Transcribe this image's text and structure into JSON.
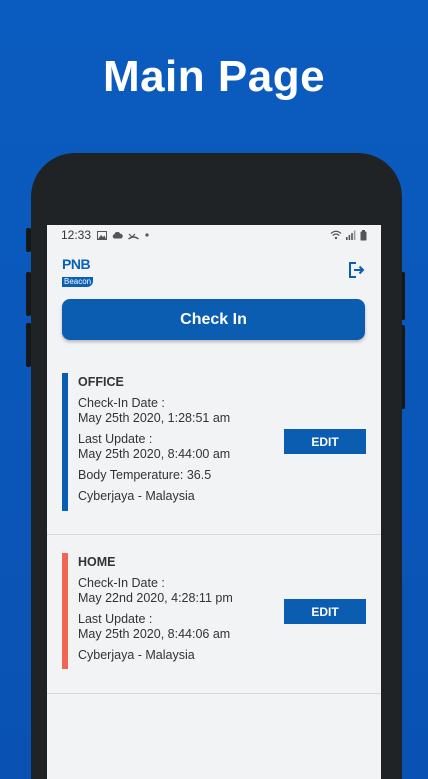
{
  "page_heading": "Main Page",
  "status_bar": {
    "time": "12:33",
    "left_icons": [
      "image-icon",
      "cloud-icon",
      "missed-call-icon",
      "dot-icon"
    ],
    "right_icons": [
      "wifi-icon",
      "signal-icon",
      "battery-icon"
    ]
  },
  "header": {
    "logo_top": "PNB",
    "logo_bottom": "Beacon",
    "logout_icon": "logout-icon"
  },
  "checkin_button": "Check In",
  "colors": {
    "brand": "#0a5db0",
    "office_accent": "#0a5db0",
    "home_accent": "#f06650"
  },
  "records": [
    {
      "title": "OFFICE",
      "checkin_label": "Check-In Date :",
      "checkin_value": "May 25th 2020, 1:28:51 am",
      "update_label": "Last Update :",
      "update_value": "May 25th 2020, 8:44:00 am",
      "temperature": "Body Temperature: 36.5",
      "location": "Cyberjaya - Malaysia",
      "edit_label": "EDIT"
    },
    {
      "title": "HOME",
      "checkin_label": "Check-In Date :",
      "checkin_value": "May 22nd 2020, 4:28:11 pm",
      "update_label": "Last Update :",
      "update_value": "May 25th 2020, 8:44:06 am",
      "location": "Cyberjaya - Malaysia",
      "edit_label": "EDIT"
    }
  ]
}
